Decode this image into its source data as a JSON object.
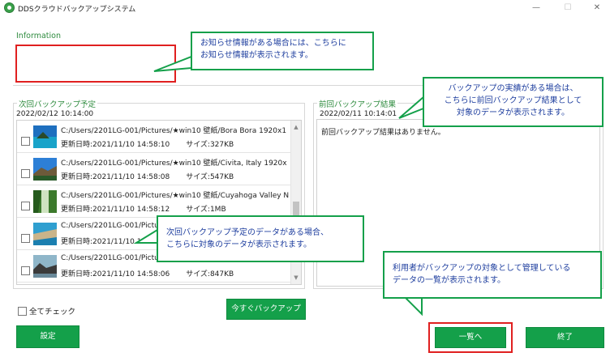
{
  "window": {
    "title": "DDSクラウドバックアップシステム",
    "minimize": "—",
    "maximize": "☐",
    "close": "✕"
  },
  "info": {
    "legend": "Information"
  },
  "next": {
    "legend": "次回バックアップ予定",
    "date": "2022/02/12 10:14:00",
    "items": [
      {
        "path": "C:/Users/2201LG-001/Pictures/★win10 壁紙/Bora Bora 1920x1",
        "updated": "更新日時:2021/11/10 14:58:10",
        "size": "サイズ:327KB"
      },
      {
        "path": "C:/Users/2201LG-001/Pictures/★win10 壁紙/Civita, Italy 1920x",
        "updated": "更新日時:2021/11/10 14:58:08",
        "size": "サイズ:547KB"
      },
      {
        "path": "C:/Users/2201LG-001/Pictures/★win10 壁紙/Cuyahoga Valley N",
        "updated": "更新日時:2021/11/10 14:58:12",
        "size": "サイズ:1MB"
      },
      {
        "path": "C:/Users/2201LG-001/Pictu",
        "updated": "更新日時:2021/11/10 14:5",
        "size": ""
      },
      {
        "path": "C:/Users/2201LG-001/Pictu",
        "updated": "更新日時:2021/11/10 14:58:06",
        "size": "サイズ:847KB"
      }
    ]
  },
  "prev": {
    "legend": "前回バックアップ結果",
    "date": "2022/02/11 10:14:01",
    "message": "前回バックアップ結果はありません。"
  },
  "controls": {
    "check_all": "全てチェック",
    "backup_now": "今すぐバックアップ",
    "settings": "設定",
    "list": "一覧へ",
    "exit": "終了"
  },
  "callouts": {
    "info": [
      "お知らせ情報がある場合には、こちらに",
      "お知らせ情報が表示されます。"
    ],
    "prev": [
      "バックアップの実績がある場合は、",
      "こちらに前回バックアップ結果として",
      "対象のデータが表示されます。"
    ],
    "next": [
      "次回バックアップ予定のデータがある場合、",
      "こちらに対象のデータが表示されます。"
    ],
    "list": [
      "利用者がバックアップの対象として管理している",
      "データの一覧が表示されます。"
    ]
  },
  "colors": {
    "accent": "#14a04a",
    "highlight": "#e02020",
    "callout_text": "#1f3f9f"
  }
}
